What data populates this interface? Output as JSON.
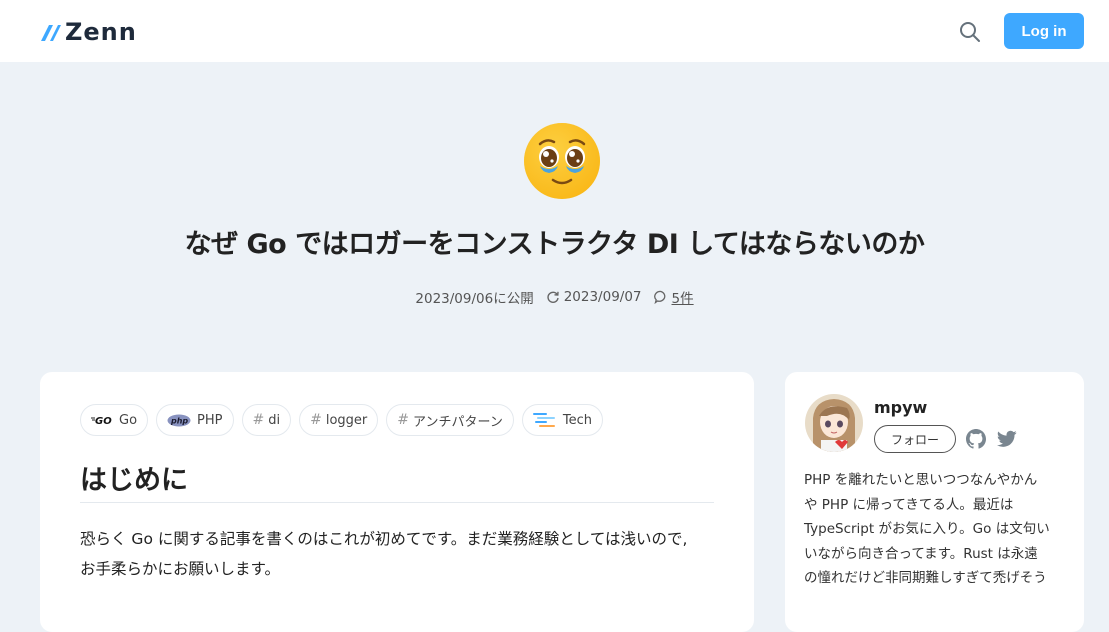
{
  "header": {
    "logo_text": "Zenn",
    "login_label": "Log in",
    "icons": [
      "search-icon"
    ]
  },
  "article": {
    "emoji": "pleading-face",
    "title": "なぜ Go ではロガーをコンストラクタ DI してはならないのか",
    "published": "2023/09/06に公開",
    "updated": "2023/09/07",
    "comments": "5件",
    "tags": [
      {
        "label": "Go",
        "icon": "go-logo-icon"
      },
      {
        "label": "PHP",
        "icon": "php-logo-icon"
      },
      {
        "label": "di",
        "icon": "hash"
      },
      {
        "label": "logger",
        "icon": "hash"
      },
      {
        "label": "アンチパターン",
        "icon": "hash"
      },
      {
        "label": "Tech",
        "icon": "tech-icon"
      }
    ],
    "heading": "はじめに",
    "paragraph_lines": [
      "恐らく Go に関する記事を書くのはこれが初めてです。まだ業務経験としては浅いので,",
      "お手柔らかにお願いします。"
    ]
  },
  "author": {
    "name": "mpyw",
    "follow_label": "フォロー",
    "bio_lines": [
      "PHP を離れたいと思いつつなんやかん",
      "や PHP に帰ってきてる人。最近は",
      "TypeScript がお気に入り。Go は文句い",
      "いながら向き合ってます。Rust は永遠",
      "の憧れだけど非同期難しすぎて禿げそう"
    ]
  },
  "colors": {
    "accent": "#3ea8ff",
    "background": "#edf2f7"
  }
}
